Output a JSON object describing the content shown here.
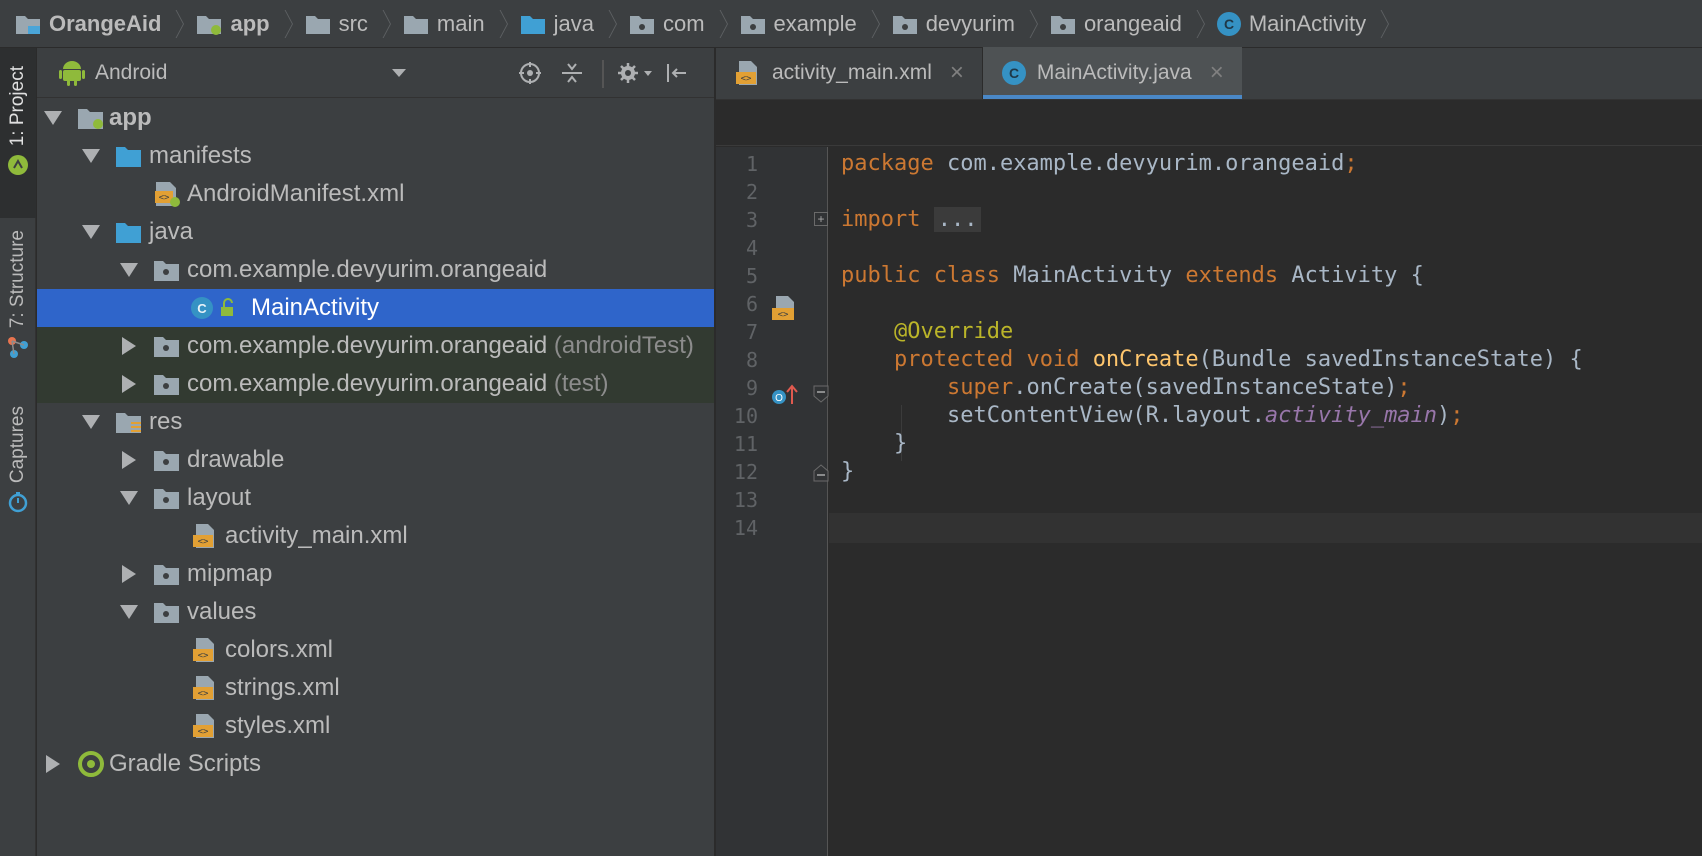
{
  "breadcrumb": [
    {
      "label": "OrangeAid",
      "bold": true,
      "icon": "project-folder-icon"
    },
    {
      "label": "app",
      "bold": true,
      "icon": "module-folder-icon"
    },
    {
      "label": "src",
      "icon": "folder-icon"
    },
    {
      "label": "main",
      "icon": "folder-icon"
    },
    {
      "label": "java",
      "icon": "source-folder-icon"
    },
    {
      "label": "com",
      "icon": "package-icon"
    },
    {
      "label": "example",
      "icon": "package-icon"
    },
    {
      "label": "devyurim",
      "icon": "package-icon"
    },
    {
      "label": "orangeaid",
      "icon": "package-icon"
    },
    {
      "label": "MainActivity",
      "icon": "class-icon"
    }
  ],
  "left_stripe": {
    "project": "1: Project",
    "structure": "7: Structure",
    "captures": "Captures"
  },
  "project_panel": {
    "view_mode": "Android",
    "tree": [
      {
        "label": "app",
        "bold": true
      },
      {
        "label": "manifests"
      },
      {
        "label": "AndroidManifest.xml"
      },
      {
        "label": "java"
      },
      {
        "label": "com.example.devyurim.orangeaid"
      },
      {
        "label": "MainActivity"
      },
      {
        "label": "com.example.devyurim.orangeaid",
        "suffix": "(androidTest)"
      },
      {
        "label": "com.example.devyurim.orangeaid",
        "suffix": "(test)"
      },
      {
        "label": "res"
      },
      {
        "label": "drawable"
      },
      {
        "label": "layout"
      },
      {
        "label": "activity_main.xml"
      },
      {
        "label": "mipmap"
      },
      {
        "label": "values"
      },
      {
        "label": "colors.xml"
      },
      {
        "label": "strings.xml"
      },
      {
        "label": "styles.xml"
      },
      {
        "label": "Gradle Scripts"
      }
    ]
  },
  "editor": {
    "tabs": [
      {
        "label": "activity_main.xml",
        "active": false
      },
      {
        "label": "MainActivity.java",
        "active": true
      }
    ],
    "line_numbers": [
      "1",
      "2",
      "3",
      "4",
      "5",
      "6",
      "7",
      "8",
      "9",
      "10",
      "11",
      "12",
      "13",
      "14"
    ],
    "code": {
      "l1_kw": "package",
      "l1_rest": " com.example.devyurim.orangeaid",
      "l1_semi": ";",
      "l3_kw": "import",
      "l3_fold": "...",
      "l6_kw1": "public",
      "l6_kw2": "class",
      "l6_name": "MainActivity",
      "l6_kw3": "extends",
      "l6_rest": "Activity {",
      "l8_ann": "@Override",
      "l9_kw1": "protected",
      "l9_kw2": "void",
      "l9_fn": "onCreate",
      "l9_rest": "(Bundle savedInstanceState) {",
      "l10_kw": "super",
      "l10_rest": ".onCreate(savedInstanceState)",
      "l10_semi": ";",
      "l11_a": "setContentView(R.layout.",
      "l11_fld": "activity_main",
      "l11_b": ")",
      "l11_semi": ";",
      "l12": "}",
      "l13": "}"
    }
  },
  "colors": {
    "selection": "#2f65ca",
    "keyword": "#cc7832",
    "annotation": "#bbb529",
    "method": "#ffc66d",
    "field": "#9876aa",
    "tab_underline": "#4a88c7"
  }
}
